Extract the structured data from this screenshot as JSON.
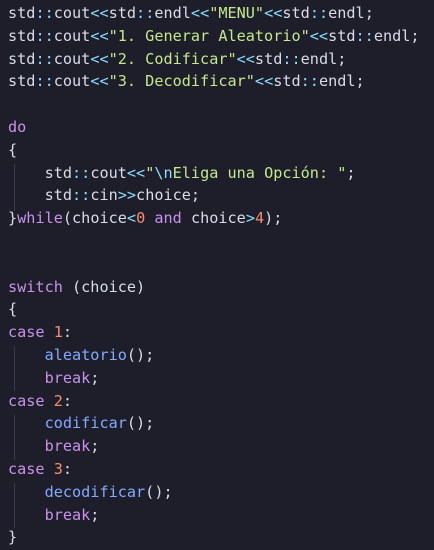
{
  "code_lines": [
    [
      {
        "t": "std",
        "c": "plain"
      },
      {
        "t": "::",
        "c": "op"
      },
      {
        "t": "cout",
        "c": "plain"
      },
      {
        "t": "<<",
        "c": "op"
      },
      {
        "t": "std",
        "c": "plain"
      },
      {
        "t": "::",
        "c": "op"
      },
      {
        "t": "endl",
        "c": "plain"
      },
      {
        "t": "<<",
        "c": "op"
      },
      {
        "t": "\"MENU\"",
        "c": "str"
      },
      {
        "t": "<<",
        "c": "op"
      },
      {
        "t": "std",
        "c": "plain"
      },
      {
        "t": "::",
        "c": "op"
      },
      {
        "t": "endl",
        "c": "plain"
      },
      {
        "t": ";",
        "c": "plain"
      }
    ],
    [
      {
        "t": "std",
        "c": "plain"
      },
      {
        "t": "::",
        "c": "op"
      },
      {
        "t": "cout",
        "c": "plain"
      },
      {
        "t": "<<",
        "c": "op"
      },
      {
        "t": "\"1. Generar Aleatorio\"",
        "c": "str"
      },
      {
        "t": "<<",
        "c": "op"
      },
      {
        "t": "std",
        "c": "plain"
      },
      {
        "t": "::",
        "c": "op"
      },
      {
        "t": "endl",
        "c": "plain"
      },
      {
        "t": ";",
        "c": "plain"
      }
    ],
    [
      {
        "t": "std",
        "c": "plain"
      },
      {
        "t": "::",
        "c": "op"
      },
      {
        "t": "cout",
        "c": "plain"
      },
      {
        "t": "<<",
        "c": "op"
      },
      {
        "t": "\"2. Codificar\"",
        "c": "str"
      },
      {
        "t": "<<",
        "c": "op"
      },
      {
        "t": "std",
        "c": "plain"
      },
      {
        "t": "::",
        "c": "op"
      },
      {
        "t": "endl",
        "c": "plain"
      },
      {
        "t": ";",
        "c": "plain"
      }
    ],
    [
      {
        "t": "std",
        "c": "plain"
      },
      {
        "t": "::",
        "c": "op"
      },
      {
        "t": "cout",
        "c": "plain"
      },
      {
        "t": "<<",
        "c": "op"
      },
      {
        "t": "\"3. Decodificar\"",
        "c": "str"
      },
      {
        "t": "<<",
        "c": "op"
      },
      {
        "t": "std",
        "c": "plain"
      },
      {
        "t": "::",
        "c": "op"
      },
      {
        "t": "endl",
        "c": "plain"
      },
      {
        "t": ";",
        "c": "plain"
      }
    ],
    [],
    [
      {
        "t": "do",
        "c": "kw"
      }
    ],
    [
      {
        "t": "{",
        "c": "plain"
      }
    ],
    [
      {
        "t": "    ",
        "c": "plain"
      },
      {
        "t": "std",
        "c": "plain"
      },
      {
        "t": "::",
        "c": "op"
      },
      {
        "t": "cout",
        "c": "plain"
      },
      {
        "t": "<<",
        "c": "op"
      },
      {
        "t": "\"",
        "c": "str"
      },
      {
        "t": "\\n",
        "c": "esc"
      },
      {
        "t": "Eliga una Opción: \"",
        "c": "str"
      },
      {
        "t": ";",
        "c": "plain"
      }
    ],
    [
      {
        "t": "    ",
        "c": "plain"
      },
      {
        "t": "std",
        "c": "plain"
      },
      {
        "t": "::",
        "c": "op"
      },
      {
        "t": "cin",
        "c": "plain"
      },
      {
        "t": ">>",
        "c": "op"
      },
      {
        "t": "choice",
        "c": "plain"
      },
      {
        "t": ";",
        "c": "plain"
      }
    ],
    [
      {
        "t": "}",
        "c": "plain"
      },
      {
        "t": "while",
        "c": "kw"
      },
      {
        "t": "(",
        "c": "plain"
      },
      {
        "t": "choice",
        "c": "plain"
      },
      {
        "t": "<",
        "c": "op"
      },
      {
        "t": "0",
        "c": "num"
      },
      {
        "t": " ",
        "c": "plain"
      },
      {
        "t": "and",
        "c": "kw"
      },
      {
        "t": " choice",
        "c": "plain"
      },
      {
        "t": ">",
        "c": "op"
      },
      {
        "t": "4",
        "c": "num"
      },
      {
        "t": ");",
        "c": "plain"
      }
    ],
    [],
    [],
    [
      {
        "t": "switch",
        "c": "kw"
      },
      {
        "t": " (choice)",
        "c": "plain"
      }
    ],
    [
      {
        "t": "{",
        "c": "plain"
      }
    ],
    [
      {
        "t": "case",
        "c": "kw"
      },
      {
        "t": " ",
        "c": "plain"
      },
      {
        "t": "1",
        "c": "num"
      },
      {
        "t": ":",
        "c": "plain"
      }
    ],
    [
      {
        "t": "    ",
        "c": "plain"
      },
      {
        "t": "aleatorio",
        "c": "fn"
      },
      {
        "t": "();",
        "c": "plain"
      }
    ],
    [
      {
        "t": "    ",
        "c": "plain"
      },
      {
        "t": "break",
        "c": "kw"
      },
      {
        "t": ";",
        "c": "plain"
      }
    ],
    [
      {
        "t": "case",
        "c": "kw"
      },
      {
        "t": " ",
        "c": "plain"
      },
      {
        "t": "2",
        "c": "num"
      },
      {
        "t": ":",
        "c": "plain"
      }
    ],
    [
      {
        "t": "    ",
        "c": "plain"
      },
      {
        "t": "codificar",
        "c": "fn"
      },
      {
        "t": "();",
        "c": "plain"
      }
    ],
    [
      {
        "t": "    ",
        "c": "plain"
      },
      {
        "t": "break",
        "c": "kw"
      },
      {
        "t": ";",
        "c": "plain"
      }
    ],
    [
      {
        "t": "case",
        "c": "kw"
      },
      {
        "t": " ",
        "c": "plain"
      },
      {
        "t": "3",
        "c": "num"
      },
      {
        "t": ":",
        "c": "plain"
      }
    ],
    [
      {
        "t": "    ",
        "c": "plain"
      },
      {
        "t": "decodificar",
        "c": "fn"
      },
      {
        "t": "();",
        "c": "plain"
      }
    ],
    [
      {
        "t": "    ",
        "c": "plain"
      },
      {
        "t": "break",
        "c": "kw"
      },
      {
        "t": ";",
        "c": "plain"
      }
    ],
    [
      {
        "t": "}",
        "c": "plain"
      }
    ]
  ],
  "colors": {
    "background": "#1e1e2a",
    "plain": "#d8dce8",
    "operator": "#89ddff",
    "string": "#c3e88d",
    "keyword": "#c792ea",
    "number": "#f78c6c",
    "function": "#82aaff"
  }
}
